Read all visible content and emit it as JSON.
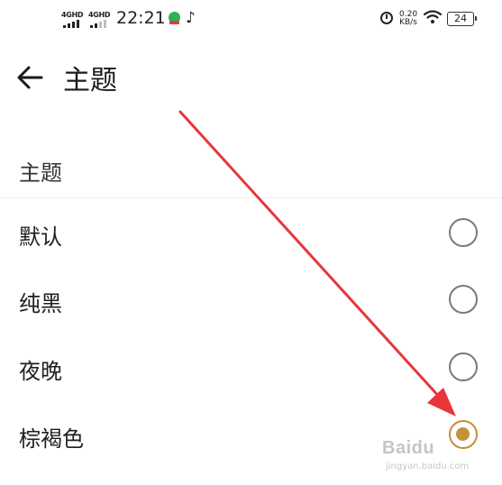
{
  "status_bar": {
    "sim1_label": "4GHD",
    "sim2_label": "4GHD",
    "time": "22:21",
    "speed_value": "0.20",
    "speed_unit": "KB/s",
    "battery": "24",
    "icons": [
      "signal-icon",
      "signal-icon",
      "app-badge-icon",
      "tiktok-icon",
      "alarm-icon",
      "wifi-icon",
      "battery-icon"
    ]
  },
  "header": {
    "title": "主题",
    "back_icon": "arrow-left-icon"
  },
  "section": {
    "title": "主题"
  },
  "options": [
    {
      "label": "默认",
      "selected": false
    },
    {
      "label": "纯黑",
      "selected": false
    },
    {
      "label": "夜晚",
      "selected": false
    },
    {
      "label": "棕褐色",
      "selected": true
    }
  ],
  "colors": {
    "accent": "#c6903b",
    "annotation_arrow": "#e8363a",
    "radio_border": "#7a7a7a"
  },
  "watermark": {
    "brand": "Baidu",
    "sub": "jingyan.baidu.com"
  }
}
